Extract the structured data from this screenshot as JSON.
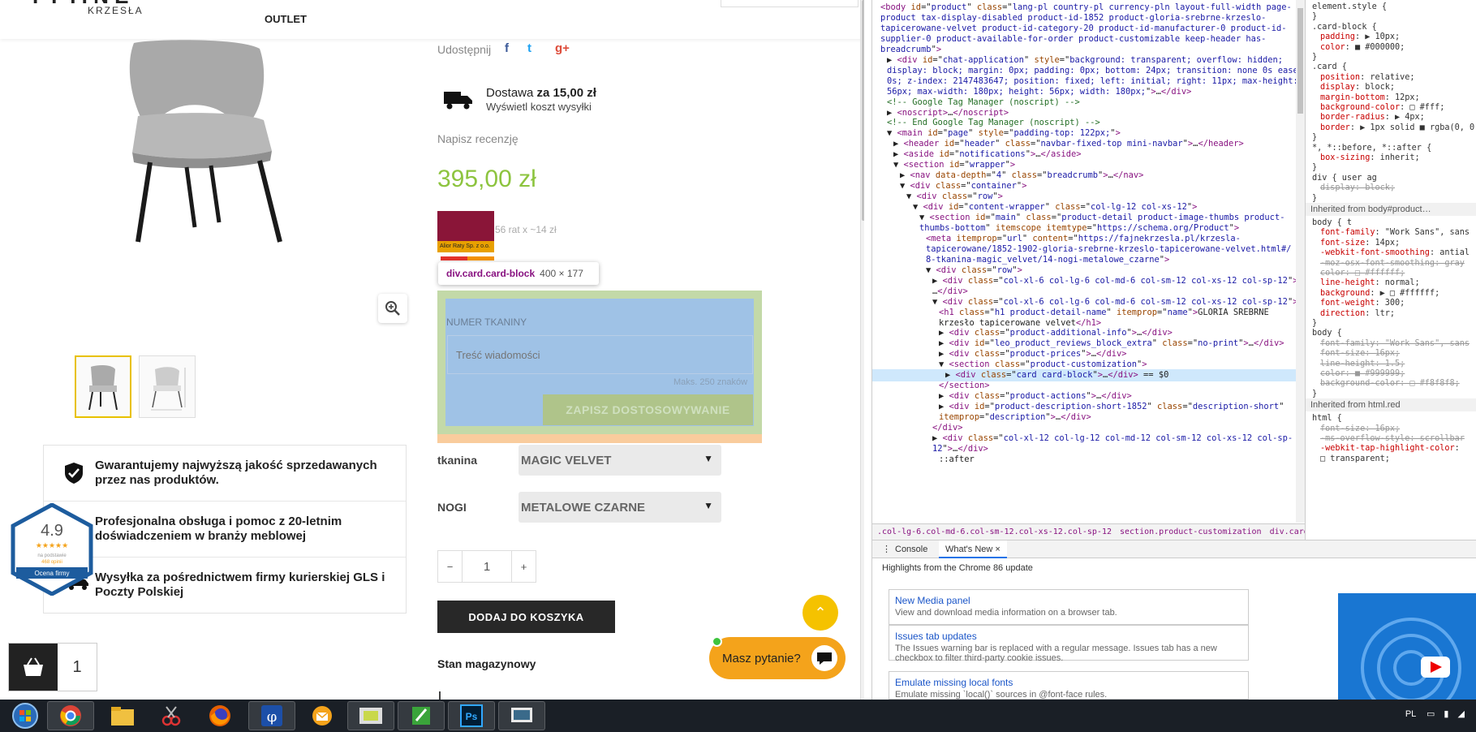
{
  "site": {
    "logo_sub": "KRZESŁA",
    "nav_outlet": "OUTLET",
    "share_label": "Udostępnij",
    "delivery_main_prefix": "Dostawa ",
    "delivery_main_bold": "za 15,00 zł",
    "delivery_sub": "Wyświetl koszt wysyłki",
    "review_link": "Napisz recenzję",
    "price": "395,00 zł",
    "alior_logo": "ALIOR",
    "alior_bar_text": "Alior Raty Sp. z o.o.",
    "installments": "56 rat x ~14 zł",
    "tooltip_selector": "div.card.card-block",
    "tooltip_size": "400 × 177",
    "customization": {
      "label": "NUMER TKANINY",
      "placeholder": "Treść wiadomości",
      "max": "Maks. 250 znaków",
      "save": "ZAPISZ DOSTOSOWYWANIE"
    },
    "options": [
      {
        "label": "tkanina",
        "value": "MAGIC VELVET"
      },
      {
        "label": "NOGI",
        "value": "METALOWE CZARNE"
      }
    ],
    "qty": {
      "minus": "−",
      "value": "1",
      "plus": "+"
    },
    "add_to_cart": "DODAJ DO KOSZYKA",
    "stock": "Stan magazynowy",
    "guarantees": [
      "Gwarantujemy najwyższą jakość sprzedawanych przez nas produktów.",
      "Profesjonalna obsługa i pomoc z 20-letnim doświadczeniem w branży meblowej",
      "Wysyłka za pośrednictwem firmy kurierskiej GLS i Poczty Polskiej"
    ],
    "badge": {
      "score": "4.9",
      "stars": "★★★★★",
      "line1": "na podstawie",
      "line2": "468 opinii",
      "label": "Ocena firmy"
    },
    "cart_count": "1",
    "chat_label": "Masz pytanie?",
    "colors": {
      "price": "#8dc43f",
      "chat": "#f4a31b",
      "scroll_top": "#f5c200",
      "dark_button": "#282828"
    }
  },
  "devtools": {
    "elements": [
      {
        "i": 0,
        "html": "<span class='tag'>&lt;body</span> <span class='attr'>id</span>=\"<span class='val'>product</span>\" <span class='attr'>class</span>=\"<span class='val'>lang-pl country-pl currency-pln layout-full-width page-</span>"
      },
      {
        "i": 0,
        "html": "<span class='val'>product tax-display-disabled product-id-1852 product-gloria-srebrne-krzeslo-</span>"
      },
      {
        "i": 0,
        "html": "<span class='val'>tapicerowane-velvet product-id-category-20 product-id-manufacturer-0 product-id-</span>"
      },
      {
        "i": 0,
        "html": "<span class='val'>supplier-0 product-available-for-order product-customizable  keep-header has-</span>"
      },
      {
        "i": 0,
        "html": "<span class='val'>breadcrumb</span>\"<span class='tag'>&gt;</span>"
      },
      {
        "i": 1,
        "html": "▶ <span class='tag'>&lt;div</span> <span class='attr'>id</span>=\"<span class='val'>chat-application</span>\" <span class='attr'>style</span>=\"<span class='val'>background: transparent; overflow: hidden;</span>"
      },
      {
        "i": 1,
        "html": "<span class='val'>display: block; margin: 0px; padding: 0px; bottom: 24px; transition: none 0s ease</span>"
      },
      {
        "i": 1,
        "html": "<span class='val'>0s; z-index: 2147483647; position: fixed; left: initial; right: 11px; max-height:</span>"
      },
      {
        "i": 1,
        "html": "<span class='val'>56px; max-width: 180px; height: 56px; width: 180px;</span>\"<span class='tag'>&gt;</span>…<span class='tag'>&lt;/div&gt;</span>"
      },
      {
        "i": 1,
        "html": "<span class='cmt'>&lt;!-- Google Tag Manager (noscript) --&gt;</span>"
      },
      {
        "i": 1,
        "html": "▶ <span class='tag'>&lt;noscript&gt;</span>…<span class='tag'>&lt;/noscript&gt;</span>"
      },
      {
        "i": 1,
        "html": "<span class='cmt'>&lt;!-- End Google Tag Manager (noscript) --&gt;</span>"
      },
      {
        "i": 1,
        "html": "▼ <span class='tag'>&lt;main</span> <span class='attr'>id</span>=\"<span class='val'>page</span>\" <span class='attr'>style</span>=\"<span class='val'>padding-top: 122px;</span>\"<span class='tag'>&gt;</span>"
      },
      {
        "i": 2,
        "html": "▶ <span class='tag'>&lt;header</span> <span class='attr'>id</span>=\"<span class='val'>header</span>\" <span class='attr'>class</span>=\"<span class='val'>navbar-fixed-top mini-navbar</span>\"<span class='tag'>&gt;</span>…<span class='tag'>&lt;/header&gt;</span>"
      },
      {
        "i": 2,
        "html": "▶ <span class='tag'>&lt;aside</span> <span class='attr'>id</span>=\"<span class='val'>notifications</span>\"<span class='tag'>&gt;</span>…<span class='tag'>&lt;/aside&gt;</span>"
      },
      {
        "i": 2,
        "html": "▼ <span class='tag'>&lt;section</span> <span class='attr'>id</span>=\"<span class='val'>wrapper</span>\"<span class='tag'>&gt;</span>"
      },
      {
        "i": 3,
        "html": "▶ <span class='tag'>&lt;nav</span> <span class='attr'>data-depth</span>=\"<span class='val'>4</span>\" <span class='attr'>class</span>=\"<span class='val'>breadcrumb</span>\"<span class='tag'>&gt;</span>…<span class='tag'>&lt;/nav&gt;</span>"
      },
      {
        "i": 3,
        "html": "▼ <span class='tag'>&lt;div</span> <span class='attr'>class</span>=\"<span class='val'>container</span>\"<span class='tag'>&gt;</span>"
      },
      {
        "i": 4,
        "html": "▼ <span class='tag'>&lt;div</span> <span class='attr'>class</span>=\"<span class='val'>row</span>\"<span class='tag'>&gt;</span>"
      },
      {
        "i": 5,
        "html": "▼ <span class='tag'>&lt;div</span> <span class='attr'>id</span>=\"<span class='val'>content-wrapper</span>\" <span class='attr'>class</span>=\"<span class='val'>col-lg-12 col-xs-12</span>\"<span class='tag'>&gt;</span>"
      },
      {
        "i": 6,
        "html": "▼ <span class='tag'>&lt;section</span> <span class='attr'>id</span>=\"<span class='val'>main</span>\" <span class='attr'>class</span>=\"<span class='val'>product-detail  product-image-thumbs product-</span>"
      },
      {
        "i": 6,
        "html": "<span class='val'>thumbs-bottom</span>\" <span class='attr'>itemscope</span> <span class='attr'>itemtype</span>=\"<span class='val'>https://schema.org/Product</span>\"<span class='tag'>&gt;</span>"
      },
      {
        "i": 7,
        "html": "<span class='tag'>&lt;meta</span> <span class='attr'>itemprop</span>=\"<span class='val'>url</span>\" <span class='attr'>content</span>=\"<span class='val'>https://fajnekrzesla.pl/krzesla-</span>"
      },
      {
        "i": 7,
        "html": "<span class='val'>tapicerowane/1852-1902-gloria-srebrne-krzeslo-tapicerowane-velvet.html#/</span>"
      },
      {
        "i": 7,
        "html": "<span class='val'>8-tkanina-magic_velvet/14-nogi-metalowe_czarne</span>\"<span class='tag'>&gt;</span>"
      },
      {
        "i": 7,
        "html": "▼ <span class='tag'>&lt;div</span> <span class='attr'>class</span>=\"<span class='val'>row</span>\"<span class='tag'>&gt;</span>"
      },
      {
        "i": 8,
        "html": "▶ <span class='tag'>&lt;div</span> <span class='attr'>class</span>=\"<span class='val'>col-xl-6 col-lg-6 col-md-6 col-sm-12 col-xs-12 col-sp-12</span>\"<span class='tag'>&gt;</span>"
      },
      {
        "i": 8,
        "html": "…<span class='tag'>&lt;/div&gt;</span>"
      },
      {
        "i": 8,
        "html": "▼ <span class='tag'>&lt;div</span> <span class='attr'>class</span>=\"<span class='val'>col-xl-6 col-lg-6 col-md-6 col-sm-12 col-xs-12 col-sp-12</span>\"<span class='tag'>&gt;</span>"
      },
      {
        "i": 9,
        "html": "<span class='tag'>&lt;h1</span> <span class='attr'>class</span>=\"<span class='val'>h1 product-detail-name</span>\" <span class='attr'>itemprop</span>=\"<span class='val'>name</span>\"<span class='tag'>&gt;</span>GLORIA SREBRNE"
      },
      {
        "i": 9,
        "html": "krzesło tapicerowane velvet<span class='tag'>&lt;/h1&gt;</span>"
      },
      {
        "i": 9,
        "html": "▶ <span class='tag'>&lt;div</span> <span class='attr'>class</span>=\"<span class='val'>product-additional-info</span>\"<span class='tag'>&gt;</span>…<span class='tag'>&lt;/div&gt;</span>"
      },
      {
        "i": 9,
        "html": "▶ <span class='tag'>&lt;div</span> <span class='attr'>id</span>=\"<span class='val'>leo_product_reviews_block_extra</span>\" <span class='attr'>class</span>=\"<span class='val'>no-print</span>\"<span class='tag'>&gt;</span>…<span class='tag'>&lt;/div&gt;</span>"
      },
      {
        "i": 9,
        "html": "▶ <span class='tag'>&lt;div</span> <span class='attr'>class</span>=\"<span class='val'>product-prices</span>\"<span class='tag'>&gt;</span>…<span class='tag'>&lt;/div&gt;</span>"
      },
      {
        "i": 9,
        "html": "▼ <span class='tag'>&lt;section</span> <span class='attr'>class</span>=\"<span class='val'>product-customization</span>\"<span class='tag'>&gt;</span>"
      },
      {
        "i": 10,
        "html": "▶ <span class='tag'>&lt;div</span> <span class='attr'>class</span>=\"<span class='val'>card card-block</span>\"<span class='tag'>&gt;</span>…<span class='tag'>&lt;/div&gt;</span> == $0",
        "selected": true
      },
      {
        "i": 9,
        "html": "<span class='tag'>&lt;/section&gt;</span>"
      },
      {
        "i": 9,
        "html": "▶ <span class='tag'>&lt;div</span> <span class='attr'>class</span>=\"<span class='val'>product-actions</span>\"<span class='tag'>&gt;</span>…<span class='tag'>&lt;/div&gt;</span>"
      },
      {
        "i": 9,
        "html": "▶ <span class='tag'>&lt;div</span> <span class='attr'>id</span>=\"<span class='val'>product-description-short-1852</span>\" <span class='attr'>class</span>=\"<span class='val'>description-short</span>\""
      },
      {
        "i": 9,
        "html": "<span class='attr'>itemprop</span>=\"<span class='val'>description</span>\"<span class='tag'>&gt;</span>…<span class='tag'>&lt;/div&gt;</span>"
      },
      {
        "i": 8,
        "html": "<span class='tag'>&lt;/div&gt;</span>"
      },
      {
        "i": 8,
        "html": "▶ <span class='tag'>&lt;div</span> <span class='attr'>class</span>=\"<span class='val'>col-xl-12 col-lg-12 col-md-12 col-sm-12 col-xs-12 col-sp-</span>"
      },
      {
        "i": 8,
        "html": "<span class='val'>12</span>\"<span class='tag'>&gt;</span>…<span class='tag'>&lt;/div&gt;</span>"
      },
      {
        "i": 9,
        "html": "::after"
      }
    ],
    "breadcrumbs": [
      ".col-lg-6.col-md-6.col-sm-12.col-xs-12.col-sp-12",
      "section.product-customization",
      "div.card.card-block"
    ],
    "styles": [
      {
        "t": "r",
        "h": "element.style {"
      },
      {
        "t": "r",
        "h": "}"
      },
      {
        "t": "r",
        "h": ".card-block {"
      },
      {
        "t": "p",
        "h": "<span class='prop'>padding</span>: ▶ 10px;"
      },
      {
        "t": "p",
        "h": "<span class='prop'>color</span>: ■ #000000;"
      },
      {
        "t": "r",
        "h": "}"
      },
      {
        "t": "r",
        "h": ".card {"
      },
      {
        "t": "p",
        "h": "<span class='prop'>position</span>: relative;"
      },
      {
        "t": "p",
        "h": "<span class='prop'>display</span>: block;"
      },
      {
        "t": "p",
        "h": "<span class='prop'>margin-bottom</span>: 12px;"
      },
      {
        "t": "p",
        "h": "<span class='prop'>background-color</span>: □ #fff;"
      },
      {
        "t": "p",
        "h": "<span class='prop'>border-radius</span>: ▶ 4px;"
      },
      {
        "t": "p",
        "h": "<span class='prop'>border</span>: ▶ 1px solid ■ rgba(0, 0"
      },
      {
        "t": "r",
        "h": "}"
      },
      {
        "t": "r",
        "h": "*, *::before, *::after {"
      },
      {
        "t": "p",
        "h": "<span class='prop'>box-sizing</span>: inherit;"
      },
      {
        "t": "r",
        "h": "}"
      },
      {
        "t": "r",
        "h": "div {                    user ag"
      },
      {
        "t": "s",
        "h": "display: block;"
      },
      {
        "t": "r",
        "h": "}"
      },
      {
        "t": "h",
        "h": "Inherited from body#product…"
      },
      {
        "t": "r",
        "h": "body {                         t"
      },
      {
        "t": "p",
        "h": "<span class='prop'>font-family</span>: \"Work Sans\", sans"
      },
      {
        "t": "p",
        "h": "<span class='prop'>font-size</span>: 14px;"
      },
      {
        "t": "p",
        "h": "<span class='prop'>-webkit-font-smoothing</span>: antial"
      },
      {
        "t": "s",
        "h": "-moz-osx-font-smoothing: gray"
      },
      {
        "t": "s",
        "h": "color: □ #ffffff;"
      },
      {
        "t": "p",
        "h": "<span class='prop'>line-height</span>: normal;"
      },
      {
        "t": "p",
        "h": "<span class='prop'>background</span>: ▶ □ #ffffff;"
      },
      {
        "t": "p",
        "h": "<span class='prop'>font-weight</span>: 300;"
      },
      {
        "t": "p",
        "h": "<span class='prop'>direction</span>: ltr;"
      },
      {
        "t": "r",
        "h": "}"
      },
      {
        "t": "r",
        "h": "body {"
      },
      {
        "t": "s",
        "h": "font-family: \"Work Sans\", sans"
      },
      {
        "t": "s",
        "h": "font-size: 16px;"
      },
      {
        "t": "s",
        "h": "line-height: 1.5;"
      },
      {
        "t": "s",
        "h": "color: ■ #999999;"
      },
      {
        "t": "s",
        "h": "background-color: □ #f8f8f8;"
      },
      {
        "t": "r",
        "h": "}"
      },
      {
        "t": "h",
        "h": "Inherited from html.red"
      },
      {
        "t": "r",
        "h": "html {"
      },
      {
        "t": "s",
        "h": "font-size: 16px;"
      },
      {
        "t": "s",
        "h": "-ms-overflow-style: scrollbar"
      },
      {
        "t": "p",
        "h": "<span class='prop'>-webkit-tap-highlight-color</span>:"
      },
      {
        "t": "p",
        "h": "    □ transparent;"
      }
    ],
    "drawer_tabs": {
      "console": "Console",
      "whats_new": "What's New",
      "close": "×"
    },
    "highlights": "Highlights from the Chrome 86 update",
    "cards": [
      {
        "title": "New Media panel",
        "desc": "View and download media information on a browser tab."
      },
      {
        "title": "Issues tab updates",
        "desc": "The Issues warning bar is replaced with a regular message. Issues tab has a new checkbox to filter third-party cookie issues."
      },
      {
        "title": "Emulate missing local fonts",
        "desc": "Emulate missing `local()` sources in @font-face rules."
      }
    ]
  },
  "taskbar": {
    "lang": "PL",
    "apps": [
      "start-orb",
      "chrome",
      "file-explorer",
      "snipping-tool",
      "firefox",
      "phi-app",
      "mail-app",
      "window-app",
      "notes-app",
      "photoshop",
      "monitor-app"
    ]
  }
}
